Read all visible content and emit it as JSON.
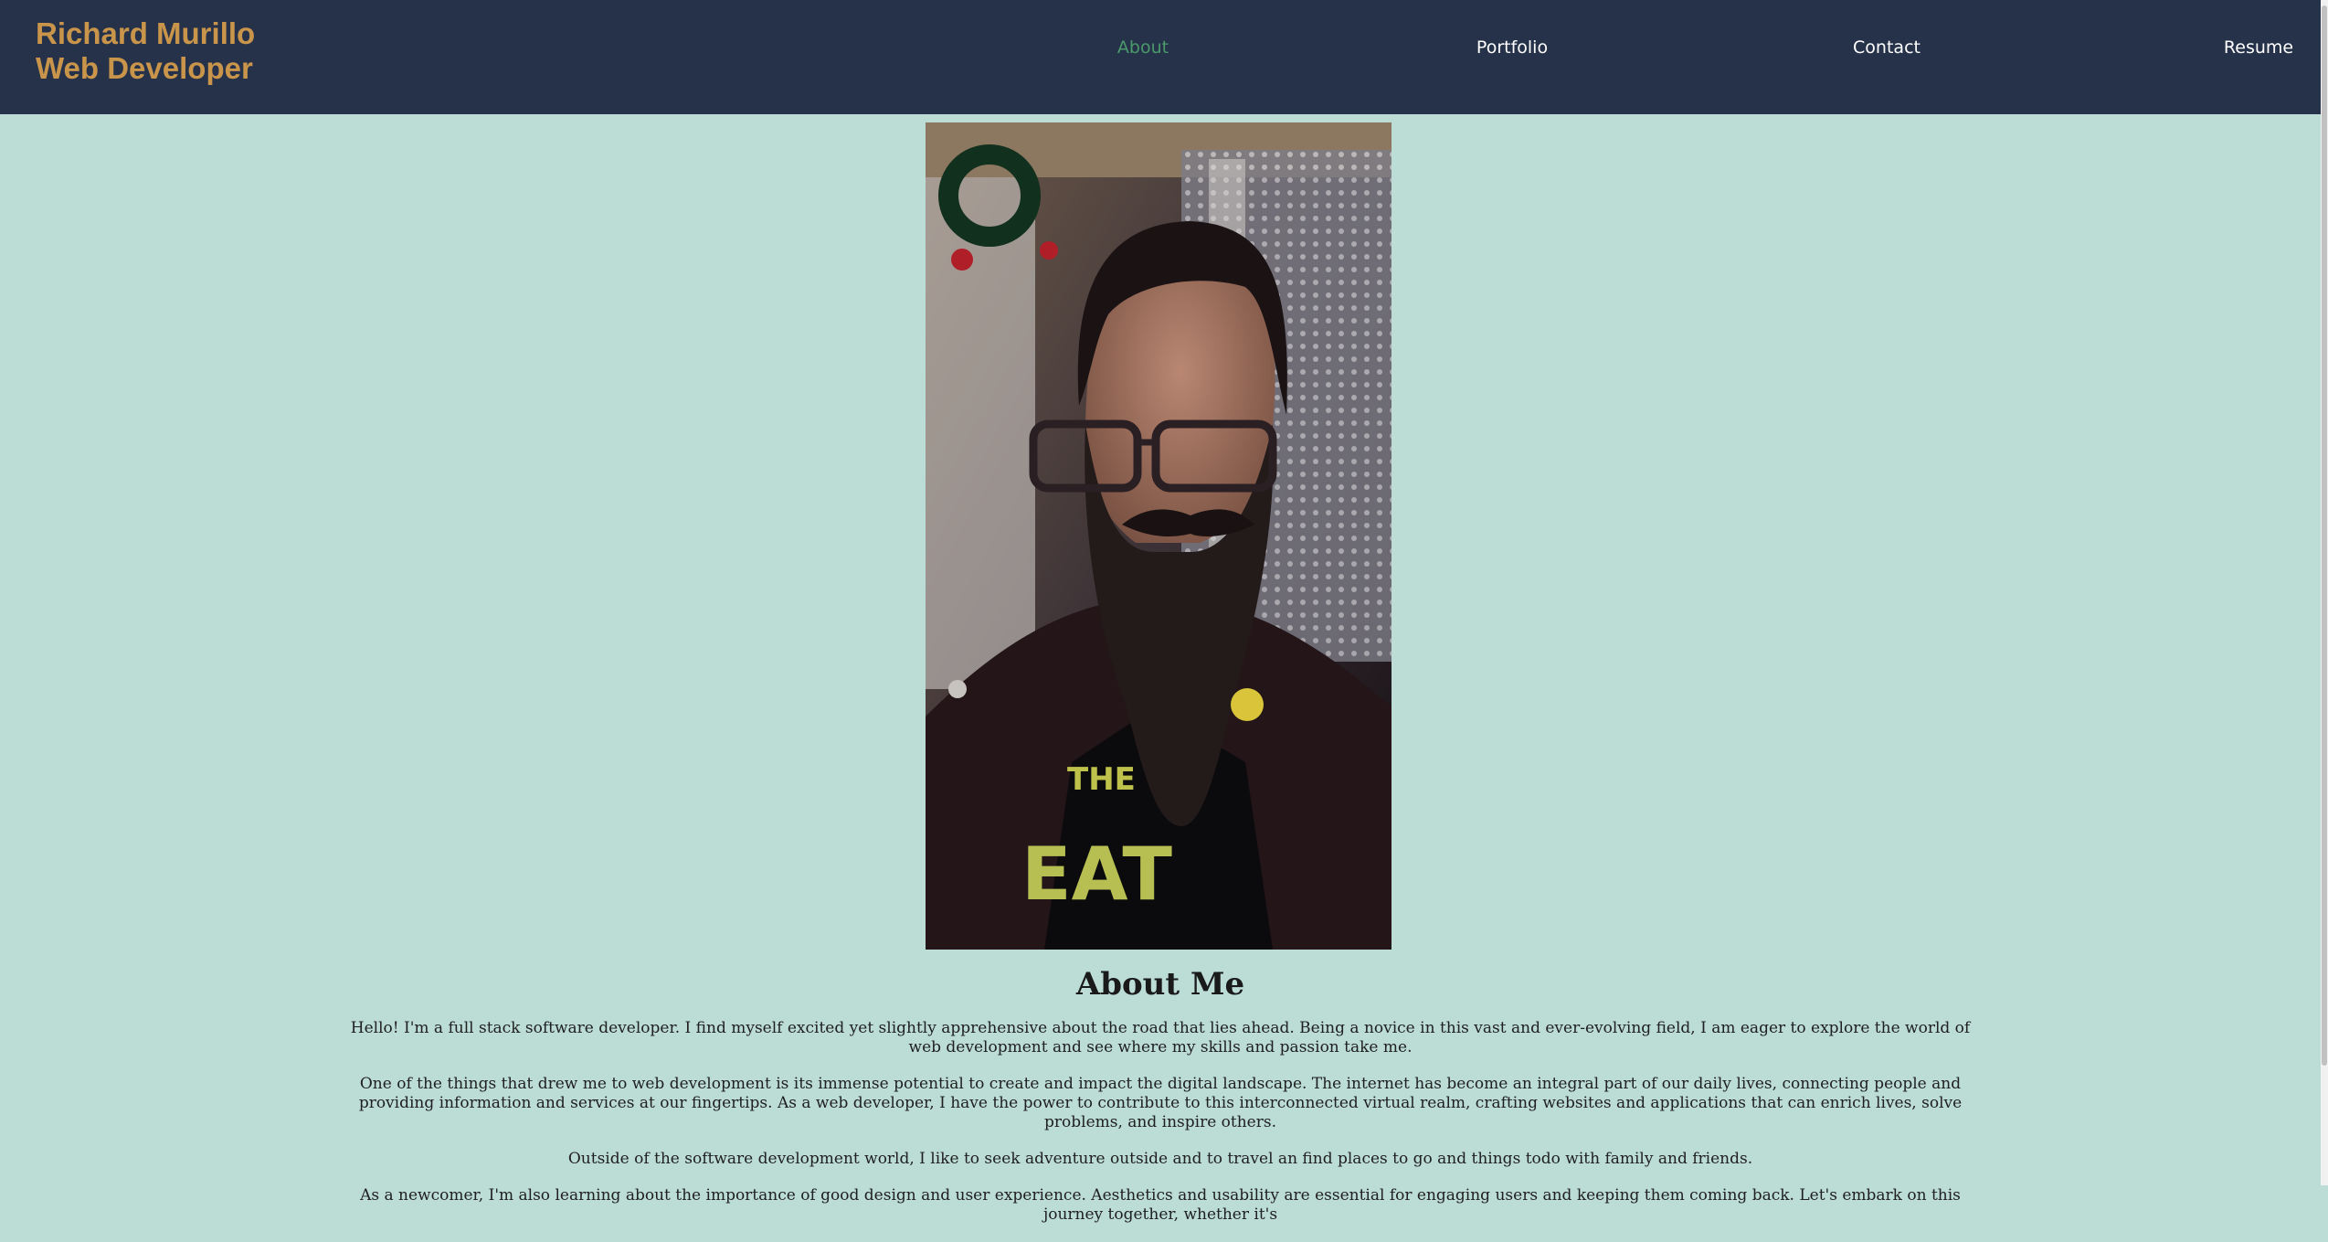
{
  "brand": {
    "line1": "Richard Murillo",
    "line2": "Web Developer"
  },
  "nav": {
    "items": [
      {
        "label": "About",
        "active": true
      },
      {
        "label": "Portfolio",
        "active": false
      },
      {
        "label": "Contact",
        "active": false
      },
      {
        "label": "Resume",
        "active": false
      }
    ]
  },
  "colors": {
    "header_bg": "#26324a",
    "page_bg": "#bcdcd6",
    "brand": "#c9954a",
    "nav_active": "#4a9a6a"
  },
  "about": {
    "title": "About Me",
    "paragraphs": [
      "Hello! I'm a full stack software developer. I find myself excited yet slightly apprehensive about the road that lies ahead. Being a novice in this vast and ever-evolving field, I am eager to explore the world of web development and see where my skills and passion take me.",
      "One of the things that drew me to web development is its immense potential to create and impact the digital landscape. The internet has become an integral part of our daily lives, connecting people and providing information and services at our fingertips. As a web developer, I have the power to contribute to this interconnected virtual realm, crafting websites and applications that can enrich lives, solve problems, and inspire others.",
      "Outside of the software development world, I like to seek adventure outside and to travel an find places to go and things todo with family and friends.",
      "As a newcomer, I'm also learning about the importance of good design and user experience. Aesthetics and usability are essential for engaging users and keeping them coming back. Let's embark on this journey together, whether it's"
    ]
  },
  "photo": {
    "shirt_text_1": "THE",
    "shirt_text_2": "EAT"
  }
}
